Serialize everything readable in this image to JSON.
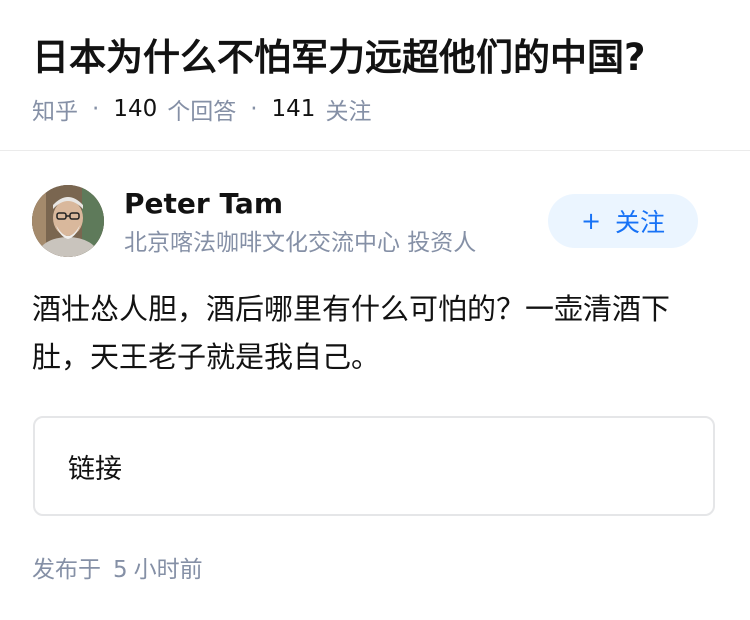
{
  "question": {
    "title": "日本为什么不怕军力远超他们的中国?"
  },
  "meta": {
    "source": "知乎",
    "separator": "·",
    "answer_count": "140",
    "answer_label": "个回答",
    "follower_count": "141",
    "follower_label": "关注"
  },
  "author": {
    "name": "Peter Tam",
    "bio": "北京喀法咖啡文化交流中心 投资人",
    "avatar_icon": "person-avatar",
    "follow_plus": "+",
    "follow_label": "关注"
  },
  "answer": {
    "content": "酒壮怂人胆，酒后哪里有什么可怕的？一壶清酒下肚，天王老子就是我自己。"
  },
  "link_card": {
    "label": "链接"
  },
  "publish": {
    "prefix": "发布于",
    "amount": "5",
    "unit": "小时前"
  },
  "colors": {
    "text": "#121212",
    "meta": "#8590a6",
    "accent": "#1772f6",
    "follow_bg": "#ebf5ff",
    "divider": "#ebebeb",
    "card_border": "#e5e6e8"
  }
}
